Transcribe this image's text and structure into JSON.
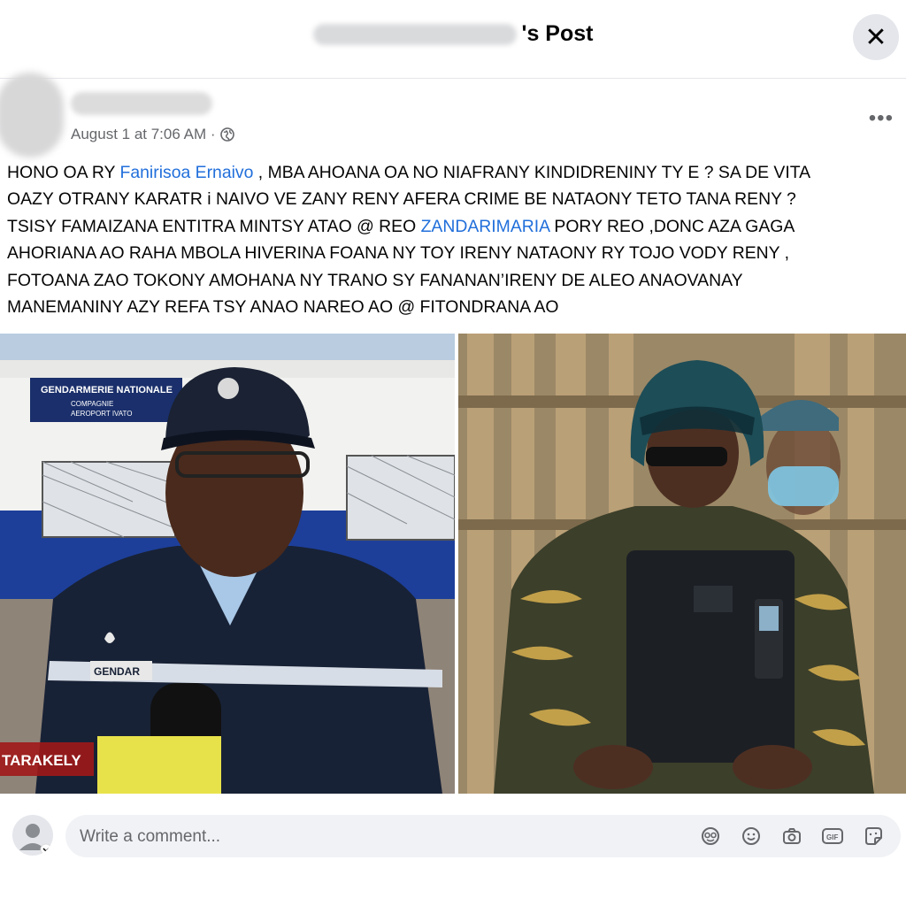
{
  "header": {
    "title_suffix": "'s Post",
    "close_label": "✕"
  },
  "post": {
    "timestamp": "August 1 at 7:06 AM ·",
    "more_label": "•••",
    "text": {
      "line1_pre": "HONO OA RY ",
      "line1_link": "Fanirisoa Ernaivo",
      "line1_post": " , MBA AHOANA OA NO NIAFRANY  KINDIDRENINY TY E ? SA DE VITA",
      "line2": "OAZY OTRANY KARATR i NAIVO VE ZANY RENY AFERA CRIME BE NATAONY TETO TANA RENY ?",
      "line3_pre": "TSISY FAMAIZANA ENTITRA MINTSY ATAO @ REO ",
      "line3_link": "ZANDARIMARIA",
      "line3_post": " PORY REO ,DONC AZA GAGA",
      "line4": "AHORIANA AO RAHA MBOLA HIVERINA FOANA NY TOY IRENY NATAONY RY TOJO VODY RENY ,",
      "line5": "FOTOANA ZAO TOKONY AMOHANA NY TRANO SY FANANAN’IRENY DE ALEO ANAOVANAY",
      "line6": "MANEMANINY AZY REFA TSY ANAO NAREO AO @ FITONDRANA AO"
    },
    "photo_left": {
      "sign_line1": "GENDARMERIE NATIONALE",
      "sign_line2": "COMPAGNIE",
      "sign_line3": "AEROPORT IVATO",
      "badge_text": "GENDAR",
      "caption": "TARAKELY"
    }
  },
  "comment": {
    "placeholder": "Write a comment...",
    "icons": [
      "avatar-icon",
      "sticker-icon",
      "emoji-icon",
      "camera-icon",
      "gif-icon",
      "sticker-face-icon"
    ],
    "gif_label": "GIF"
  },
  "colors": {
    "link": "#216fdb",
    "muted": "#65676b",
    "close_bg": "#e4e6eb",
    "comment_bg": "#f0f2f5"
  }
}
